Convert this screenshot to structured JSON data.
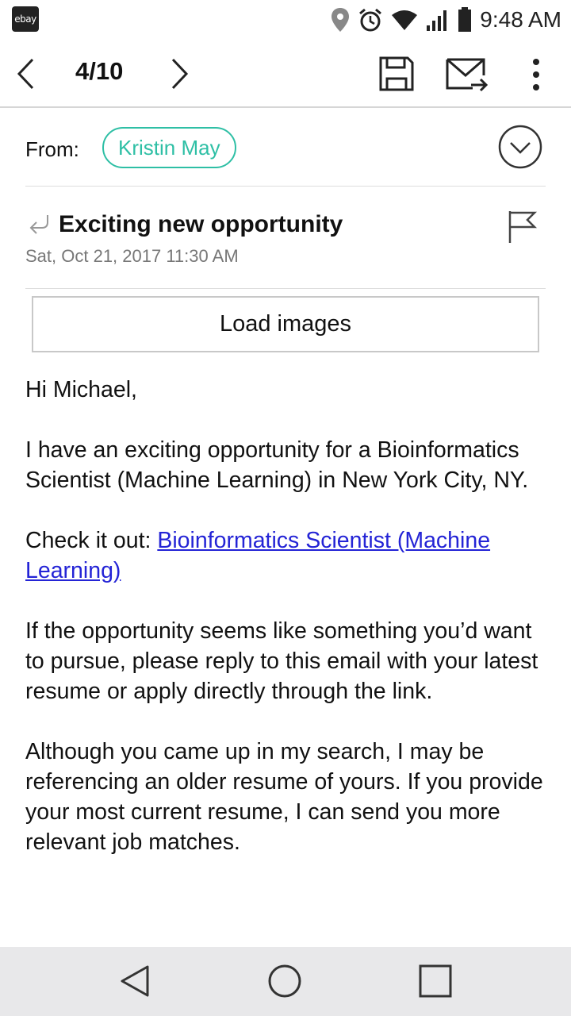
{
  "status_bar": {
    "app_badge": "ebay",
    "time": "9:48 AM"
  },
  "toolbar": {
    "counter": "4/10"
  },
  "header": {
    "from_label": "From:",
    "sender": "Kristin May",
    "subject": "Exciting new opportunity",
    "date": "Sat, Oct 21, 2017 11:30 AM"
  },
  "load_images_label": "Load images",
  "body": {
    "greeting": "Hi Michael,",
    "para1": "I have an exciting opportunity for a Bioinformatics Scientist (Machine Learning) in New York City, NY.",
    "check_prefix": "Check it out: ",
    "link_text": "Bioinformatics Scientist (Machine Learning)",
    "para3": "If the opportunity seems like something you’d want to pursue, please reply to this email with your latest resume or apply directly through the link.",
    "para4": "Although you came up in my search, I may be referencing an older resume of yours. If you provide your most current resume, I can send you more relevant job matches."
  },
  "colors": {
    "accent": "#2ebfa5",
    "link": "#2424d6",
    "nav_bg": "#e8e8ea"
  }
}
